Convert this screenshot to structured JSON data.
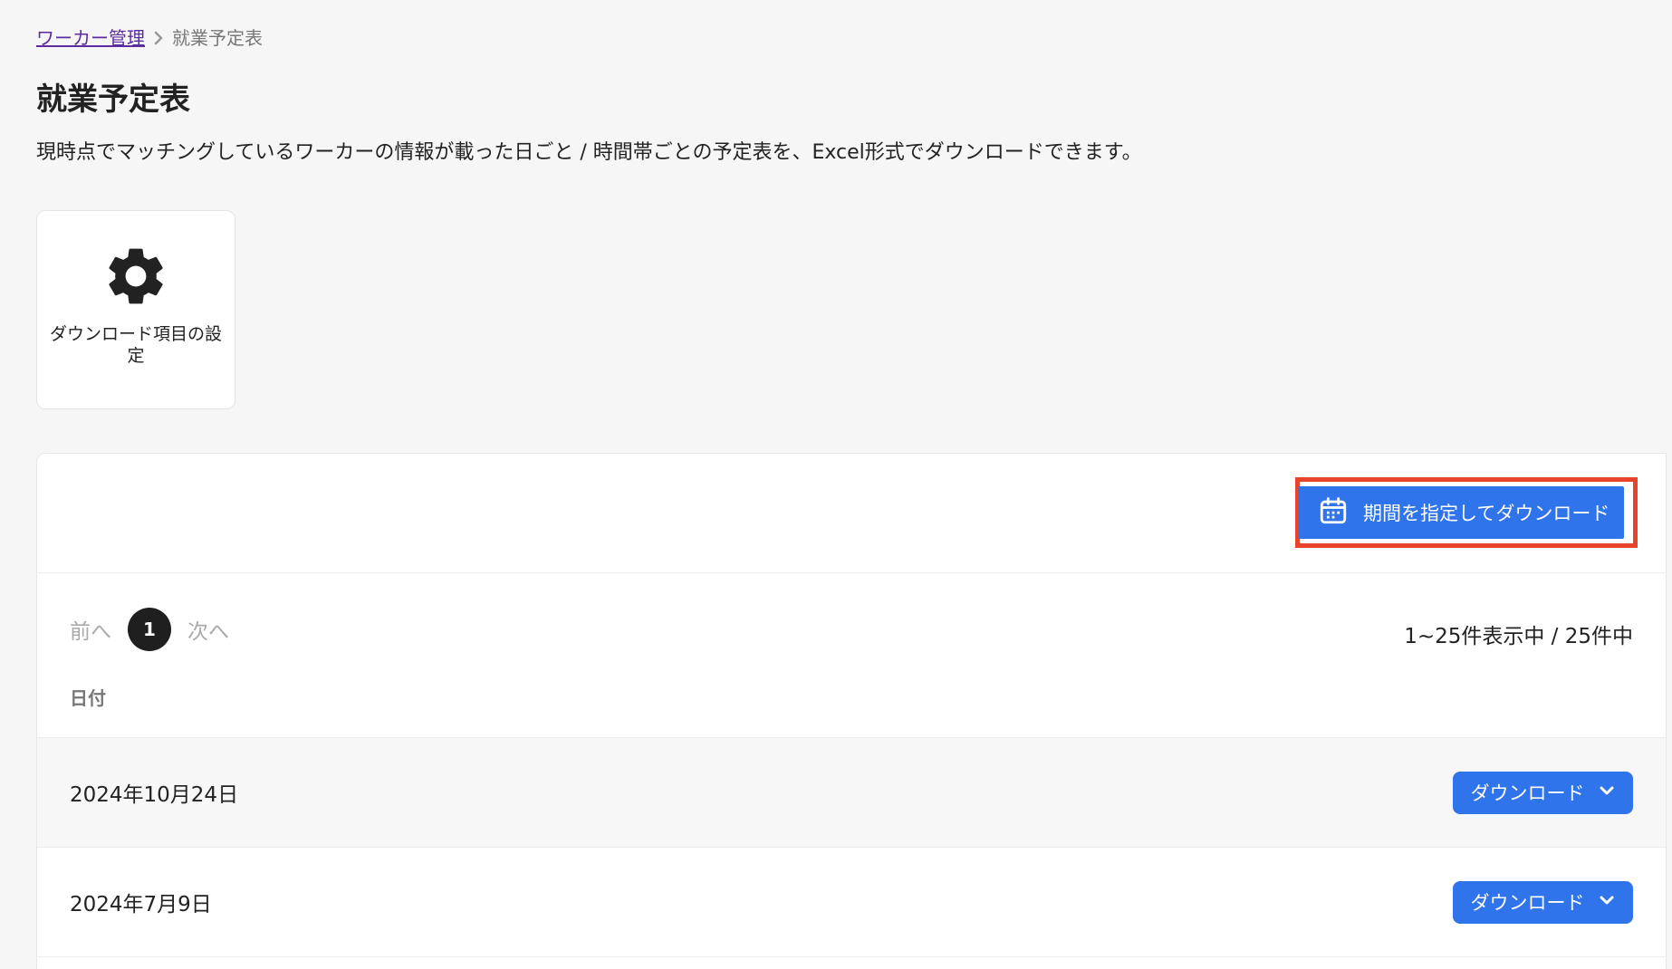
{
  "breadcrumb": {
    "parent": "ワーカー管理",
    "current": "就業予定表"
  },
  "page": {
    "title": "就業予定表",
    "description": "現時点でマッチングしているワーカーの情報が載った日ごと / 時間帯ごとの予定表を、Excel形式でダウンロードできます。"
  },
  "settings_card": {
    "icon": "gear-icon",
    "label": "ダウンロード項目の設定"
  },
  "toolbar": {
    "period_download_label": "期間を指定してダウンロード",
    "period_download_icon": "calendar-icon"
  },
  "pagination": {
    "prev_label": "前へ",
    "current_page": "1",
    "next_label": "次へ",
    "count_text": "1~25件表示中 / 25件中"
  },
  "table": {
    "header_date": "日付",
    "rows": [
      {
        "date": "2024年10月24日",
        "button_label": "ダウンロード"
      },
      {
        "date": "2024年7月9日",
        "button_label": "ダウンロード"
      }
    ]
  },
  "colors": {
    "primary": "#2f74ea",
    "highlight": "#e8442c",
    "breadcrumb_link": "#5b2ca0",
    "page_background": "#f6f6f7"
  }
}
